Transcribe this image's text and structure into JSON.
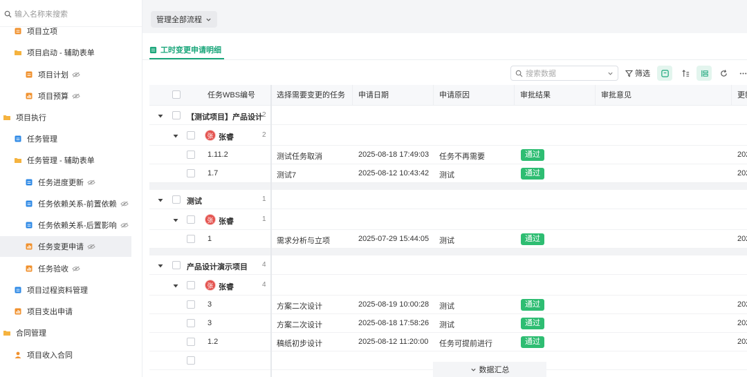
{
  "sidebar": {
    "search_placeholder": "输入名称来搜索",
    "items": [
      {
        "label": "项目立项",
        "icon": "doc-orange-icon"
      },
      {
        "label": "项目启动 - 辅助表单",
        "icon": "folder-icon"
      },
      {
        "label": "项目计划",
        "icon": "doc-orange-icon"
      },
      {
        "label": "项目预算",
        "icon": "chart-orange-icon"
      },
      {
        "label": "项目执行",
        "icon": "folder-icon"
      },
      {
        "label": "任务管理",
        "icon": "doc-blue-icon"
      },
      {
        "label": "任务管理 - 辅助表单",
        "icon": "folder-icon"
      },
      {
        "label": "任务进度更新",
        "icon": "doc-blue-icon"
      },
      {
        "label": "任务依赖关系-前置依赖",
        "icon": "doc-blue-icon"
      },
      {
        "label": "任务依赖关系-后置影响",
        "icon": "doc-blue-icon"
      },
      {
        "label": "任务变更申请",
        "icon": "chart-orange-icon"
      },
      {
        "label": "任务验收",
        "icon": "chart-orange-icon"
      },
      {
        "label": "项目过程资料管理",
        "icon": "doc-blue-icon"
      },
      {
        "label": "项目支出申请",
        "icon": "chart-orange-icon"
      },
      {
        "label": "合同管理",
        "icon": "folder-icon"
      },
      {
        "label": "项目收入合同",
        "icon": "person-orange-icon"
      }
    ]
  },
  "topbar": {
    "flow_label": "管理全部流程"
  },
  "view": {
    "tab_label": "工时变更申请明细"
  },
  "toolbar": {
    "search_placeholder": "搜索数据",
    "filter_label": "筛选"
  },
  "colors": {
    "accent": "#1aa67a",
    "approved": "#2ebd72",
    "avatar": "#e4534f"
  },
  "table": {
    "headers": [
      "任务WBS编号",
      "选择需要变更的任务",
      "申请日期",
      "申请原因",
      "审批结果",
      "审批意见",
      "更新"
    ],
    "groups": [
      {
        "title": "【测试项目】产品设计",
        "count": "2",
        "user": {
          "avatar": "张",
          "name": "张睿",
          "count": "2"
        },
        "rows": [
          {
            "wbs": "1.11.2",
            "task": "测试任务取消",
            "date": "2025-08-18 17:49:03",
            "reason": "任务不再需要",
            "result": "通过",
            "update": "202"
          },
          {
            "wbs": "1.7",
            "task": "测试7",
            "date": "2025-08-12 10:43:42",
            "reason": "测试",
            "result": "通过",
            "update": "202"
          }
        ]
      },
      {
        "title": "测试",
        "count": "1",
        "user": {
          "avatar": "张",
          "name": "张睿",
          "count": "1"
        },
        "rows": [
          {
            "wbs": "1",
            "task": "需求分析与立项",
            "date": "2025-07-29 15:44:05",
            "reason": "测试",
            "result": "通过",
            "update": "202"
          }
        ]
      },
      {
        "title": "产品设计演示项目",
        "count": "4",
        "user": {
          "avatar": "张",
          "name": "张睿",
          "count": "4"
        },
        "rows": [
          {
            "wbs": "3",
            "task": "方案二次设计",
            "date": "2025-08-19 10:00:28",
            "reason": "测试",
            "result": "通过",
            "update": "202"
          },
          {
            "wbs": "3",
            "task": "方案二次设计",
            "date": "2025-08-18 17:58:26",
            "reason": "测试",
            "result": "通过",
            "update": "202"
          },
          {
            "wbs": "1.2",
            "task": "稿纸初步设计",
            "date": "2025-08-12 11:20:00",
            "reason": "任务可提前进行",
            "result": "通过",
            "update": "202"
          }
        ]
      }
    ]
  },
  "footer": {
    "summary_label": "数据汇总"
  }
}
